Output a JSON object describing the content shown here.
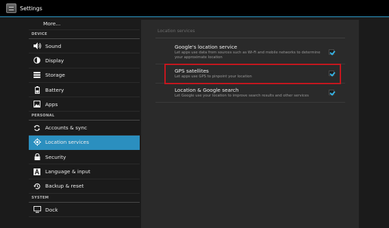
{
  "actionbar": {
    "title": "Settings",
    "icon": "settings-app-icon"
  },
  "sidebar": {
    "more": "More...",
    "device_header": "DEVICE",
    "device_items": [
      {
        "label": "Sound",
        "icon": "speaker-icon"
      },
      {
        "label": "Display",
        "icon": "display-brightness-icon"
      },
      {
        "label": "Storage",
        "icon": "storage-icon"
      },
      {
        "label": "Battery",
        "icon": "battery-icon"
      },
      {
        "label": "Apps",
        "icon": "apps-icon"
      }
    ],
    "personal_header": "PERSONAL",
    "personal_items": [
      {
        "label": "Accounts & sync",
        "icon": "sync-icon"
      },
      {
        "label": "Location services",
        "icon": "location-icon",
        "selected": true
      },
      {
        "label": "Security",
        "icon": "lock-icon"
      },
      {
        "label": "Language & input",
        "icon": "keyboard-letter-icon"
      },
      {
        "label": "Backup & reset",
        "icon": "backup-restore-icon"
      }
    ],
    "system_header": "SYSTEM",
    "system_items": [
      {
        "label": "Dock",
        "icon": "dock-monitor-icon"
      }
    ]
  },
  "panel": {
    "section_title": "Location services",
    "prefs": [
      {
        "title": "Google's location service",
        "summary": "Let apps use data from sources such as Wi-Fi and mobile networks to determine your approximate location",
        "checked": true
      },
      {
        "title": "GPS satellites",
        "summary": "Let apps use GPS to pinpoint your location",
        "checked": true,
        "highlighted": true
      },
      {
        "title": "Location & Google search",
        "summary": "Let Google use your location to improve search results and other services",
        "checked": true
      }
    ]
  },
  "colors": {
    "accent": "#2b8fbf",
    "highlight_border": "#c8161e",
    "check": "#35b4e6"
  }
}
